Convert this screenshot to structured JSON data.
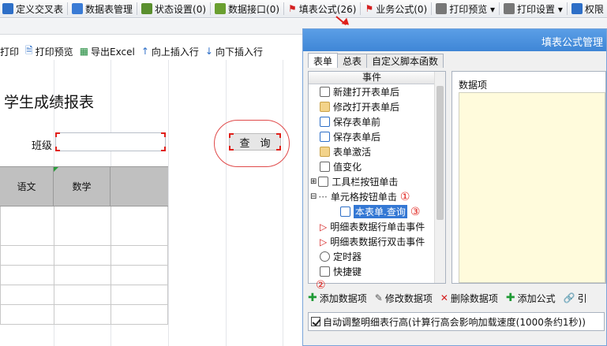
{
  "topbar": {
    "items": [
      {
        "label": "定义交叉表",
        "icon": "crosstab-icon",
        "color": "#2e6fc7"
      },
      {
        "label": "数据表管理",
        "icon": "table-manage-icon",
        "color": "#3a7bd5"
      },
      {
        "label": "状态设置(0)",
        "icon": "status-icon",
        "color": "#5a8f2e"
      },
      {
        "label": "数据接口(0)",
        "icon": "data-interface-icon",
        "color": "#6a9f30"
      },
      {
        "label": "填表公式(26)",
        "icon": "flag-icon",
        "color": "#d42020"
      },
      {
        "label": "业务公式(0)",
        "icon": "flag-icon",
        "color": "#d42020"
      },
      {
        "label": "打印预览 ▾",
        "icon": "print-preview-icon",
        "color": "#444"
      },
      {
        "label": "打印设置 ▾",
        "icon": "print-settings-icon",
        "color": "#444"
      },
      {
        "label": "权限",
        "icon": "permission-icon",
        "color": "#2e6fc7"
      }
    ]
  },
  "toolbar2": {
    "items": [
      {
        "label": "打印",
        "icon": ""
      },
      {
        "label": "打印预览",
        "icon": "print-preview-icon"
      },
      {
        "label": "导出Excel",
        "icon": "excel-icon"
      },
      {
        "label": "向上插入行",
        "icon": "insert-up-icon"
      },
      {
        "label": "向下插入行",
        "icon": "insert-down-icon"
      }
    ]
  },
  "sheet": {
    "title": "学生成绩报表",
    "class_label": "班级",
    "query_button": [
      "查",
      "询"
    ],
    "columns": [
      "语文",
      "数学",
      ""
    ]
  },
  "dialog": {
    "title": "填表公式管理",
    "tabs": [
      "表单",
      "总表",
      "自定义脚本函数"
    ],
    "tree_header": "事件",
    "tree_items": [
      {
        "label": "新建打开表单后"
      },
      {
        "label": "修改打开表单后"
      },
      {
        "label": "保存表单前"
      },
      {
        "label": "保存表单后"
      },
      {
        "label": "表单激活"
      },
      {
        "label": "值变化"
      },
      {
        "label": "工具栏按钮单击"
      },
      {
        "label": "单元格按钮单击",
        "marker": "①"
      },
      {
        "label": "本表单.查询",
        "marker": "③",
        "selected": true
      },
      {
        "label": "明细表数据行单击事件"
      },
      {
        "label": "明细表数据行双击事件"
      },
      {
        "label": "定时器"
      },
      {
        "label": "快捷键"
      }
    ],
    "right_label": "数据项",
    "actions": [
      {
        "label": "添加数据项",
        "icon": "plus-icon",
        "marker": "②"
      },
      {
        "label": "修改数据项",
        "icon": "edit-icon"
      },
      {
        "label": "删除数据项",
        "icon": "delete-icon"
      },
      {
        "label": "添加公式",
        "icon": "plus-icon"
      },
      {
        "label": "引",
        "icon": "link-icon"
      }
    ],
    "checkbox_label": "自动调整明细表行高(计算行高会影响加载速度(1000条约1秒))"
  }
}
